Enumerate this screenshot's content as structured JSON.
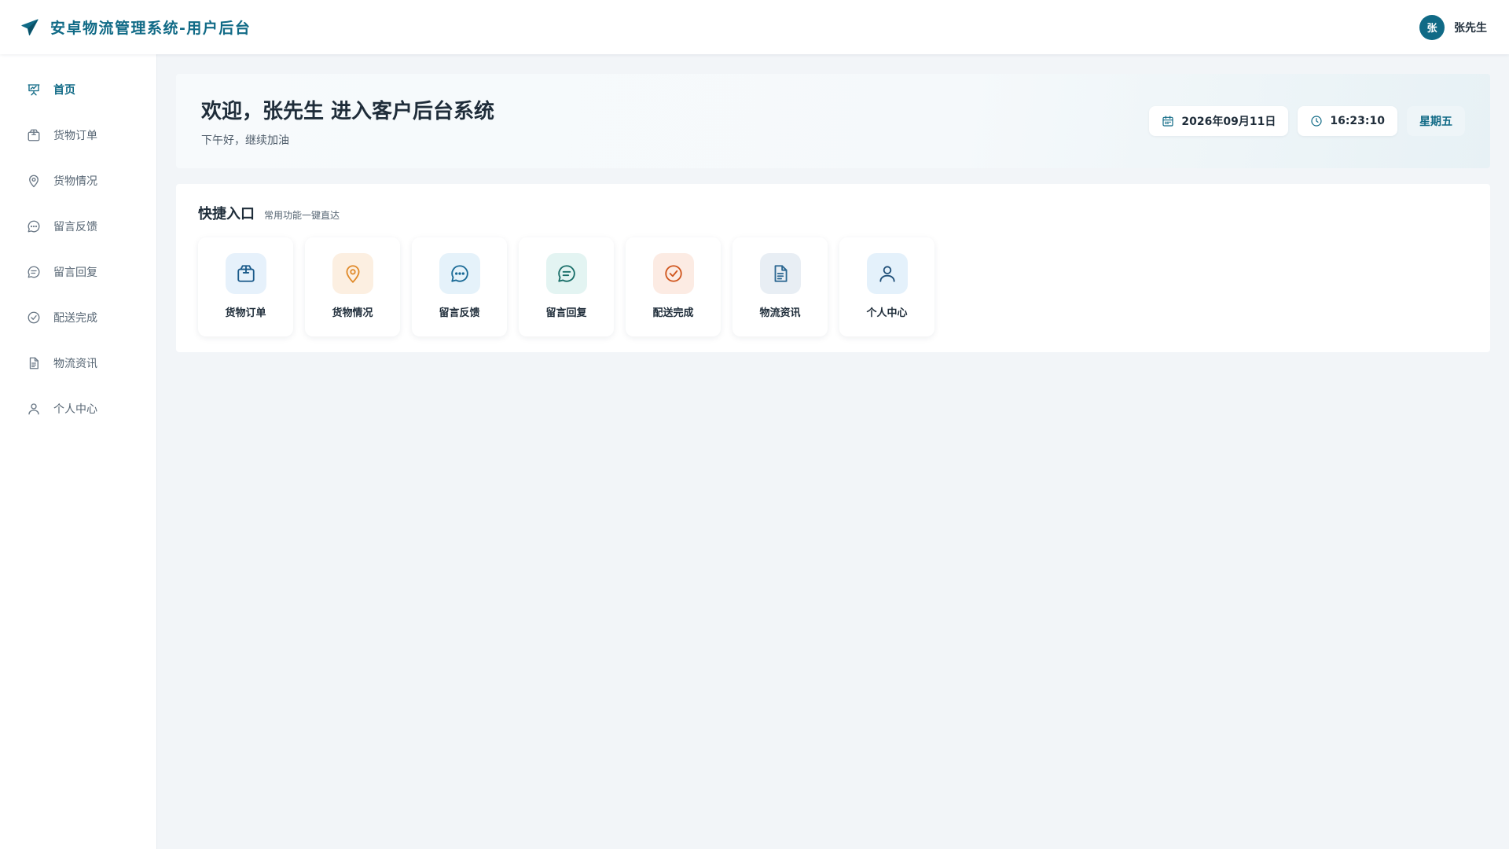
{
  "header": {
    "app_title": "安卓物流管理系统-用户后台",
    "logo_icon": "paper-plane-icon",
    "user": {
      "avatar_text": "张",
      "name": "张先生"
    }
  },
  "sidebar": {
    "items": [
      {
        "label": "首页",
        "icon": "presentation-chart-icon",
        "active": true
      },
      {
        "label": "货物订单",
        "icon": "package-icon",
        "active": false
      },
      {
        "label": "货物情况",
        "icon": "map-pin-icon",
        "active": false
      },
      {
        "label": "留言反馈",
        "icon": "chat-dots-icon",
        "active": false
      },
      {
        "label": "留言回复",
        "icon": "chat-lines-icon",
        "active": false
      },
      {
        "label": "配送完成",
        "icon": "check-circle-icon",
        "active": false
      },
      {
        "label": "物流资讯",
        "icon": "document-icon",
        "active": false
      },
      {
        "label": "个人中心",
        "icon": "user-icon",
        "active": false
      }
    ]
  },
  "welcome": {
    "title": "欢迎，张先生 进入客户后台系统",
    "subtitle": "下午好，继续加油",
    "date": "2026年09月11日",
    "time": "16:23:10",
    "weekday": "星期五"
  },
  "quick_entry": {
    "title": "快捷入口",
    "subtitle": "常用功能一键直达",
    "tiles": [
      {
        "label": "货物订单",
        "icon": "package-icon",
        "color": "#1a5a8a"
      },
      {
        "label": "货物情况",
        "icon": "map-pin-icon",
        "color": "#e08a2a"
      },
      {
        "label": "留言反馈",
        "icon": "chat-dots-icon",
        "color": "#1a6a96"
      },
      {
        "label": "留言回复",
        "icon": "chat-lines-icon",
        "color": "#186e68"
      },
      {
        "label": "配送完成",
        "icon": "check-circle-icon",
        "color": "#d0551c"
      },
      {
        "label": "物流资讯",
        "icon": "document-icon",
        "color": "#2a6690"
      },
      {
        "label": "个人中心",
        "icon": "user-icon",
        "color": "#1f4f78"
      }
    ]
  },
  "colors": {
    "primary": "#106a86",
    "background": "#f2f5f8",
    "surface": "#ffffff"
  }
}
